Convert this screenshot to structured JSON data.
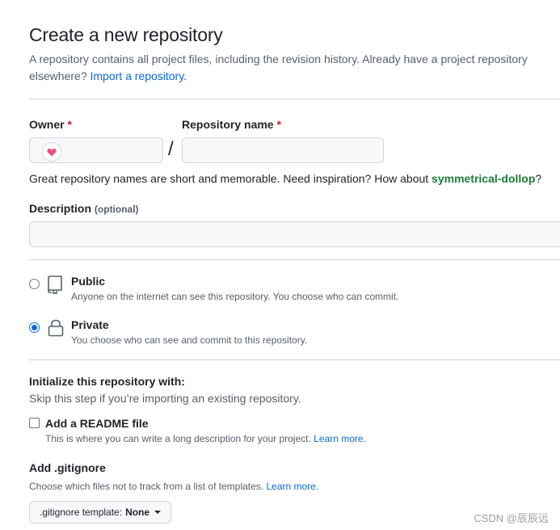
{
  "header": {
    "title": "Create a new repository",
    "subtitle": "A repository contains all project files, including the revision history. Already have a project repository elsewhere?",
    "import_link": "Import a repository."
  },
  "owner": {
    "label": "Owner",
    "required_mark": "*",
    "avatar_icon": "heart-avatar-icon"
  },
  "separator": "/",
  "repo_name": {
    "label": "Repository name",
    "required_mark": "*",
    "value": ""
  },
  "name_hint": {
    "text": "Great repository names are short and memorable. Need inspiration? How about",
    "suggestion": "symmetrical-dollop",
    "end": "?"
  },
  "description": {
    "label": "Description",
    "optional": "(optional)",
    "value": ""
  },
  "visibility": {
    "options": [
      {
        "title": "Public",
        "desc": "Anyone on the internet can see this repository. You choose who can commit.",
        "icon": "repo-icon",
        "checked": false
      },
      {
        "title": "Private",
        "desc": "You choose who can see and commit to this repository.",
        "icon": "lock-icon",
        "checked": true
      }
    ]
  },
  "initialize": {
    "title": "Initialize this repository with:",
    "desc": "Skip this step if you’re importing an existing repository.",
    "readme_label": "Add a README file",
    "readme_checked": false,
    "readme_desc": "This is where you can write a long description for your project.",
    "readme_link": "Learn more."
  },
  "gitignore": {
    "title": "Add .gitignore",
    "desc": "Choose which files not to track from a list of templates.",
    "link": "Learn more.",
    "select_prefix": ".gitignore template:",
    "select_value": "None"
  },
  "watermark": "CSDN @辰辰远",
  "colors": {
    "accent": "#0969da",
    "required": "#cf222e",
    "suggestion": "#1a7f37",
    "heart": "#e5547a"
  }
}
